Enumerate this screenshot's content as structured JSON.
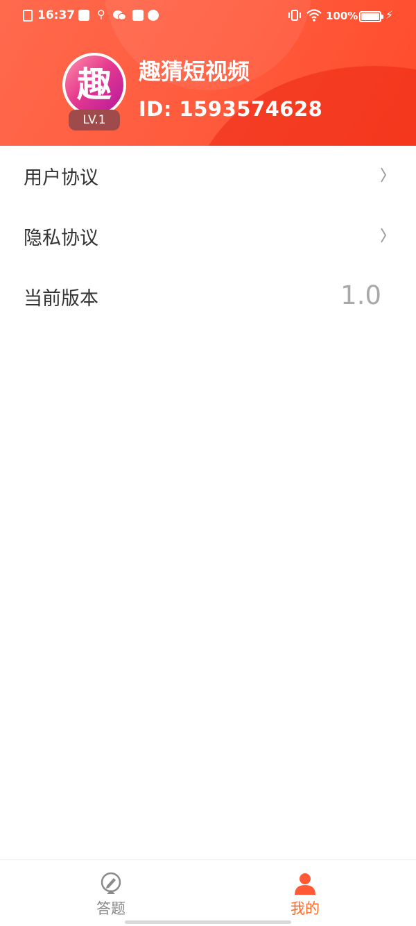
{
  "status_bar": {
    "time": "16:37",
    "battery_percent": "100%"
  },
  "profile": {
    "app_name": "趣猜短视频",
    "user_id": "ID: 1593574628",
    "level": "LV.1",
    "avatar_glyph": "趣"
  },
  "menu": {
    "items": [
      {
        "label": "用户协议",
        "icon": "chevron-right-icon"
      },
      {
        "label": "隐私协议",
        "icon": "chevron-right-icon"
      },
      {
        "label": "当前版本",
        "value": "1.0"
      }
    ]
  },
  "tabbar": {
    "tabs": [
      {
        "label": "答题",
        "icon": "pencil-icon",
        "active": false
      },
      {
        "label": "我的",
        "icon": "user-icon",
        "active": true
      }
    ]
  },
  "colors": {
    "header": "#ff5a3c",
    "active_tab": "#ff6a2a",
    "inactive_tab": "#888888",
    "version_text": "#a8a8a8"
  }
}
